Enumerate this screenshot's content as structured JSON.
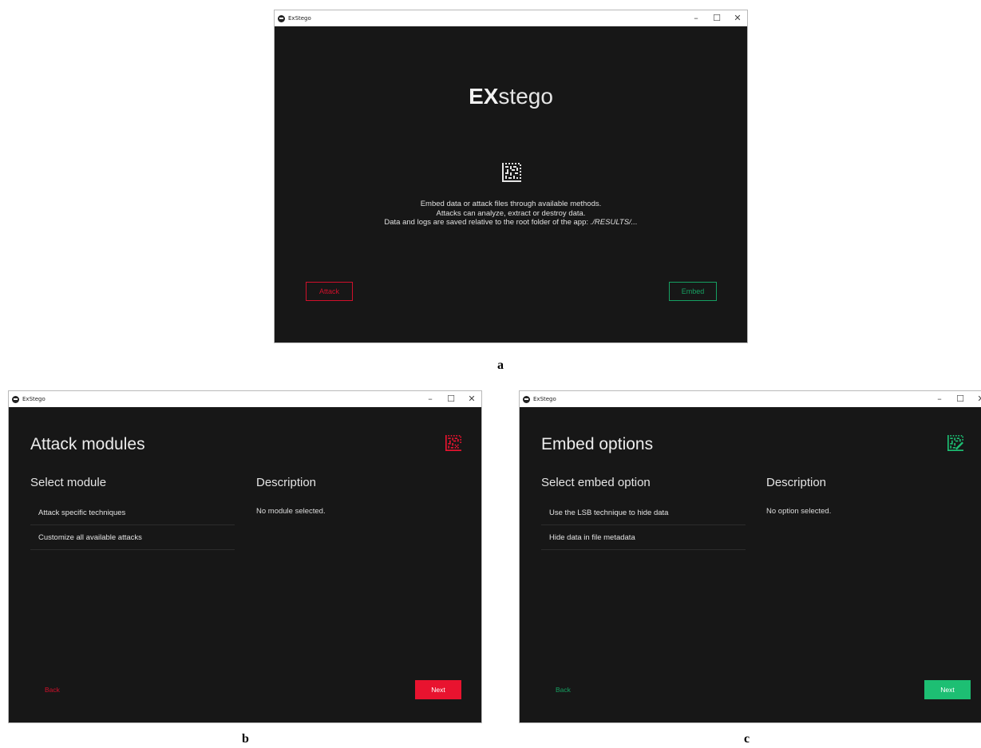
{
  "colors": {
    "attack_red": "#e8132f",
    "embed_green": "#1dbf73",
    "window_bg": "#171717"
  },
  "window_a": {
    "title": "ExStego",
    "brand_bold": "EX",
    "brand_rest": "stego",
    "code_icon": "datamatrix-icon",
    "desc_line1": "Embed data or attack files through available methods.",
    "desc_line2": "Attacks can analyze, extract or destroy data.",
    "desc_line3_prefix": "Data and logs are saved relative to the root folder of the app: ",
    "desc_line3_path": "./RESULTS/...",
    "attack_label": "Attack",
    "embed_label": "Embed",
    "panel_letter": "a"
  },
  "window_b": {
    "title": "ExStego",
    "page_title": "Attack modules",
    "select_heading": "Select module",
    "desc_heading": "Description",
    "items": [
      {
        "label": "Attack specific techniques"
      },
      {
        "label": "Customize all available attacks"
      }
    ],
    "desc_text": "No module selected.",
    "back_label": "Back",
    "next_label": "Next",
    "panel_letter": "b"
  },
  "window_c": {
    "title": "ExStego",
    "page_title": "Embed options",
    "select_heading": "Select embed option",
    "desc_heading": "Description",
    "items": [
      {
        "label": "Use the LSB technique to hide data"
      },
      {
        "label": "Hide data in file metadata"
      }
    ],
    "desc_text": "No option selected.",
    "back_label": "Back",
    "next_label": "Next",
    "panel_letter": "c"
  },
  "window_controls": {
    "minimize": "–",
    "maximize": "☐",
    "close": "✕"
  }
}
